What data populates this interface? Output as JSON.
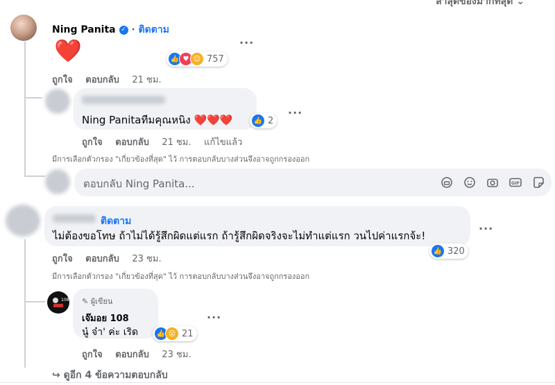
{
  "header": {
    "sort_label": "ล่าสุดของมากที่สุด"
  },
  "comment1": {
    "author": "Ning Panita",
    "follow": "ติดตาม",
    "body_emoji": "❤️",
    "reaction_count": "757",
    "like_label": "ถูกใจ",
    "reply_label": "ตอบกลับ",
    "time": "21 ชม."
  },
  "reply1": {
    "body": "Ning Panitaทีมคุณหนิง ❤️❤️❤️",
    "reaction_count": "2",
    "like_label": "ถูกใจ",
    "reply_label": "ตอบกลับ",
    "time": "21 ชม.",
    "edited": "แก้ไขแล้ว"
  },
  "filter_note_1": "มีการเลือกตัวกรอง \"เกี่ยวข้องที่สุด\" ไว้ การตอบกลับบางส่วนจึงอาจถูกกรองออก",
  "reply_input": {
    "placeholder": "ตอบกลับ Ning Panita..."
  },
  "comment2": {
    "follow": "ติดตาม",
    "body": "ไม่ต้องขอโทษ ถ้าไม่ได้รู้สึกผิดแต่แรก ถ้ารู้สึกผิดจริงจะไม่ทำแต่แรก วนไปค่าแรกจ้ะ!",
    "reaction_count": "320",
    "like_label": "ถูกใจ",
    "reply_label": "ตอบกลับ",
    "time": "23 ชม."
  },
  "filter_note_2": "มีการเลือกตัวกรอง \"เกี่ยวข้องที่สุด\" ไว้ การตอบกลับบางส่วนจึงอาจถูกกรองออก",
  "reply2": {
    "badge": "ผู้เขียน",
    "author": "เจ๊มอย 108",
    "body": "นู๋ จ๋า' ค่ะ เริด",
    "reaction_count": "21",
    "like_label": "ถูกใจ",
    "reply_label": "ตอบกลับ",
    "time": "23 ชม."
  },
  "more_replies": "ดูอีก 4 ข้อความตอบกลับ",
  "colors": {
    "accent": "#1877f2",
    "bubble": "#f0f2f5",
    "muted": "#65676b"
  }
}
